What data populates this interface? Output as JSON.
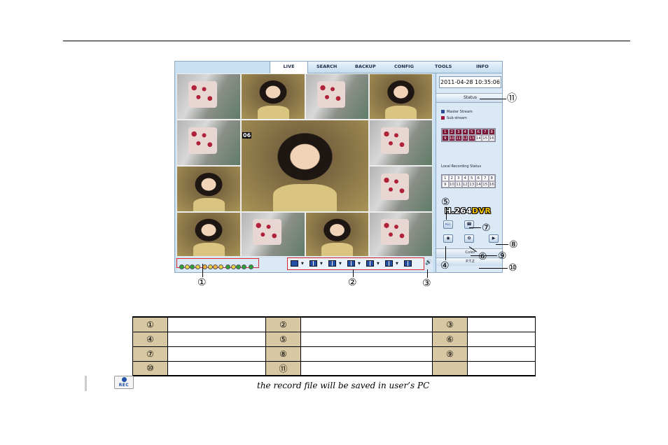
{
  "menu": [
    "LIVE",
    "SEARCH",
    "BACKUP",
    "CONFIG",
    "TOOLS",
    "INFO"
  ],
  "active_menu": "LIVE",
  "datetime": "2011-04-28 10:35:06",
  "status_label": "Status",
  "legend": {
    "master": "Master Stream",
    "sub": "Sub-stream",
    "master_color": "#2d4e96",
    "sub_color": "#a0143c"
  },
  "channels_row1": [
    "1",
    "2",
    "3",
    "4",
    "5",
    "6",
    "7",
    "8"
  ],
  "channels_row2": [
    "9",
    "10",
    "11",
    "12",
    "13",
    "14",
    "15",
    "16"
  ],
  "channels_active_count": 13,
  "local_recording_label": "Local Recording Status",
  "big_channel_label": "06",
  "logo_prefix": "H.264",
  "logo_suffix": "DVR",
  "rec_label": "REC",
  "color_label": "Color",
  "ptz_label": "P.T.Z",
  "callouts": [
    "①",
    "②",
    "③",
    "④",
    "⑤",
    "⑥",
    "⑦",
    "⑧",
    "⑨",
    "⑩",
    "⑪"
  ],
  "keys_table": [
    [
      "①",
      "",
      "②",
      "",
      "③",
      ""
    ],
    [
      "④",
      "",
      "⑤",
      "",
      "⑥",
      ""
    ],
    [
      "⑦",
      "",
      "⑧",
      "",
      "⑨",
      ""
    ],
    [
      "⑩",
      "",
      "⑪",
      "",
      "",
      ""
    ]
  ],
  "note_text": "the record file will be saved in user’s PC",
  "colors": {
    "accent_red": "#e0242b",
    "tile_border": "#eeeeee",
    "table_shade": "#d8c7a3"
  }
}
